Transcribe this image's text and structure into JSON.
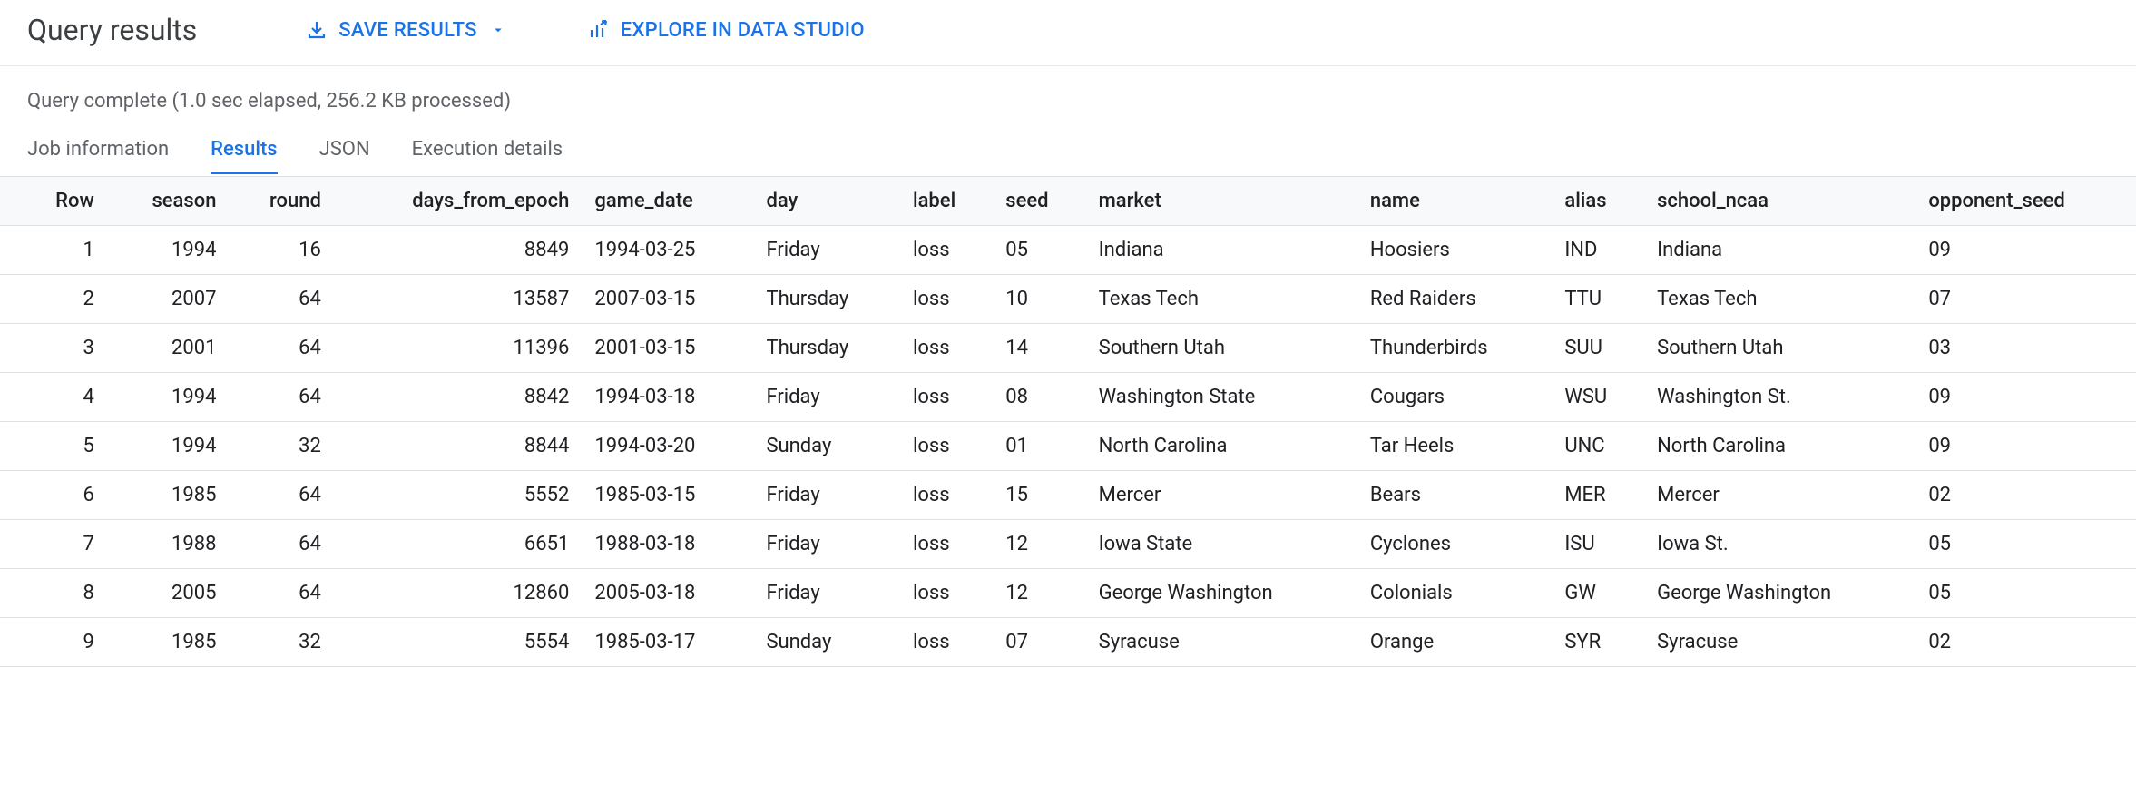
{
  "header": {
    "title": "Query results",
    "save_results": "SAVE RESULTS",
    "explore": "EXPLORE IN DATA STUDIO"
  },
  "status": "Query complete (1.0 sec elapsed, 256.2 KB processed)",
  "tabs": {
    "job_information": "Job information",
    "results": "Results",
    "json": "JSON",
    "execution_details": "Execution details"
  },
  "columns": [
    "Row",
    "season",
    "round",
    "days_from_epoch",
    "game_date",
    "day",
    "label",
    "seed",
    "market",
    "name",
    "alias",
    "school_ncaa",
    "opponent_seed"
  ],
  "numeric_cols": [
    0,
    1,
    2,
    3
  ],
  "rows": [
    [
      "1",
      "1994",
      "16",
      "8849",
      "1994-03-25",
      "Friday",
      "loss",
      "05",
      "Indiana",
      "Hoosiers",
      "IND",
      "Indiana",
      "09"
    ],
    [
      "2",
      "2007",
      "64",
      "13587",
      "2007-03-15",
      "Thursday",
      "loss",
      "10",
      "Texas Tech",
      "Red Raiders",
      "TTU",
      "Texas Tech",
      "07"
    ],
    [
      "3",
      "2001",
      "64",
      "11396",
      "2001-03-15",
      "Thursday",
      "loss",
      "14",
      "Southern Utah",
      "Thunderbirds",
      "SUU",
      "Southern Utah",
      "03"
    ],
    [
      "4",
      "1994",
      "64",
      "8842",
      "1994-03-18",
      "Friday",
      "loss",
      "08",
      "Washington State",
      "Cougars",
      "WSU",
      "Washington St.",
      "09"
    ],
    [
      "5",
      "1994",
      "32",
      "8844",
      "1994-03-20",
      "Sunday",
      "loss",
      "01",
      "North Carolina",
      "Tar Heels",
      "UNC",
      "North Carolina",
      "09"
    ],
    [
      "6",
      "1985",
      "64",
      "5552",
      "1985-03-15",
      "Friday",
      "loss",
      "15",
      "Mercer",
      "Bears",
      "MER",
      "Mercer",
      "02"
    ],
    [
      "7",
      "1988",
      "64",
      "6651",
      "1988-03-18",
      "Friday",
      "loss",
      "12",
      "Iowa State",
      "Cyclones",
      "ISU",
      "Iowa St.",
      "05"
    ],
    [
      "8",
      "2005",
      "64",
      "12860",
      "2005-03-18",
      "Friday",
      "loss",
      "12",
      "George Washington",
      "Colonials",
      "GW",
      "George Washington",
      "05"
    ],
    [
      "9",
      "1985",
      "32",
      "5554",
      "1985-03-17",
      "Sunday",
      "loss",
      "07",
      "Syracuse",
      "Orange",
      "SYR",
      "Syracuse",
      "02"
    ]
  ]
}
